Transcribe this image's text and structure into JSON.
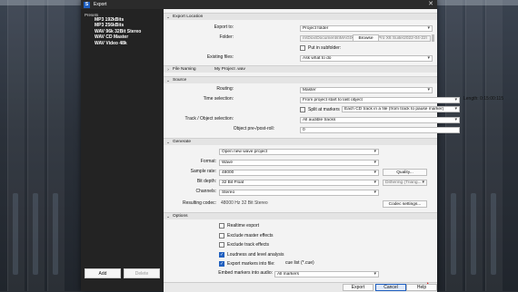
{
  "window": {
    "title": "Export",
    "app_icon_letter": "S",
    "close_glyph": "✕"
  },
  "presets": {
    "header": "Presets",
    "items": [
      "MP3 192kBits",
      "MP3 256kBits",
      "WAV 96k 32Bit Stereo",
      "WAV CD Master",
      "WAV Video 48k"
    ],
    "add_label": "Add",
    "delete_label": "Delete"
  },
  "sections": {
    "export_location": "Export Location",
    "file_naming": "File Naming",
    "source": "Source",
    "generate": "Generate",
    "options": "Options"
  },
  "export_location": {
    "export_to_label": "Export to:",
    "export_to_value": "Project folder",
    "folder_label": "Folder:",
    "folder_value": "m\\Dox\\Documents\\MAGIX\\Samplitude Pro X6 Suite\\2022-04-22\\",
    "browse_label": "Browse",
    "put_in_subfolder": "Put in subfolder:",
    "existing_files_label": "Existing files:",
    "existing_files_value": "Ask what to do"
  },
  "file_naming": {
    "value": "My Project .wav"
  },
  "source": {
    "routing_label": "Routing:",
    "routing_value": "Master",
    "time_selection_label": "Time selection:",
    "time_selection_value": "From project start to last object",
    "length_text": "Length: 0:15:00:115",
    "split_at_markers": "Split at markers",
    "split_value": "Each CD track in a file (from track to pause marker)",
    "track_object_label": "Track / Object selection:",
    "track_object_value": "All audible tracks",
    "object_preroll_label": "Object pre-/post-roll:",
    "object_preroll_value": "0"
  },
  "generate": {
    "mode_value": "Open new wave project",
    "format_label": "Format:",
    "format_value": "Wave",
    "sample_rate_label": "Sample rate:",
    "sample_rate_value": "48000",
    "quality_button": "Quality...",
    "bit_depth_label": "Bit depth:",
    "bit_depth_value": "32 Bit Float",
    "dithering_value": "Dithering (Triang...",
    "channels_label": "Channels:",
    "channels_value": "Stereo",
    "resulting_codec_label": "Resulting codec:",
    "resulting_codec_value": "48000 Hz  32 Bit  Stereo",
    "codec_settings_button": "Codec settings..."
  },
  "options": {
    "realtime_export": "Realtime export",
    "exclude_master_effects": "Exclude master effects",
    "exclude_track_effects": "Exclude track effects",
    "loudness_analysis": "Loudness and level analysis",
    "export_markers": "Export markers into file:",
    "export_markers_value": "cue list (*.cue)",
    "embed_markers_label": "Embed markers into audio:",
    "embed_markers_value": "All markers"
  },
  "footer": {
    "export_label": "Export",
    "cancel_label": "Cancel",
    "help_label": "Help"
  },
  "colors": {
    "accent": "#1f5fbf",
    "sidebar": "#232323",
    "titlebar": "#2b2b2b"
  }
}
